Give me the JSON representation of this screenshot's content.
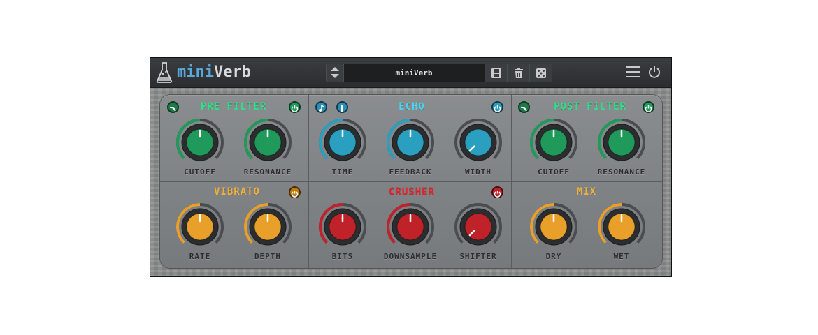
{
  "app": {
    "title_prefix": "mini",
    "title_suffix": "Verb"
  },
  "preset": {
    "name": "miniVerb"
  },
  "colors": {
    "green": "#1f9a5a",
    "teal": "#2a9fbf",
    "orange": "#e8a02a",
    "red": "#c0222a",
    "green_text": "#2ee08a",
    "teal_text": "#4ad4f0",
    "orange_text": "#f0b040",
    "red_text": "#e8202a"
  },
  "sections": {
    "pre_filter": {
      "title": "PRE FILTER",
      "knobs": [
        {
          "label": "CUTOFF",
          "value": 0.5
        },
        {
          "label": "RESONANCE",
          "value": 0.5
        }
      ]
    },
    "echo": {
      "title": "ECHO",
      "knobs": [
        {
          "label": "TIME",
          "value": 0.5
        },
        {
          "label": "FEEDBACK",
          "value": 0.5
        },
        {
          "label": "WIDTH",
          "value": 0.0
        }
      ]
    },
    "post_filter": {
      "title": "POST FILTER",
      "knobs": [
        {
          "label": "CUTOFF",
          "value": 0.5
        },
        {
          "label": "RESONANCE",
          "value": 0.5
        }
      ]
    },
    "vibrato": {
      "title": "VIBRATO",
      "knobs": [
        {
          "label": "RATE",
          "value": 0.5
        },
        {
          "label": "DEPTH",
          "value": 0.5
        }
      ]
    },
    "crusher": {
      "title": "CRUSHER",
      "knobs": [
        {
          "label": "BITS",
          "value": 0.5
        },
        {
          "label": "DOWNSAMPLE",
          "value": 0.5
        },
        {
          "label": "SHIFTER",
          "value": 0.0
        }
      ]
    },
    "mix": {
      "title": "MIX",
      "knobs": [
        {
          "label": "DRY",
          "value": 0.5
        },
        {
          "label": "WET",
          "value": 0.5
        }
      ]
    }
  }
}
